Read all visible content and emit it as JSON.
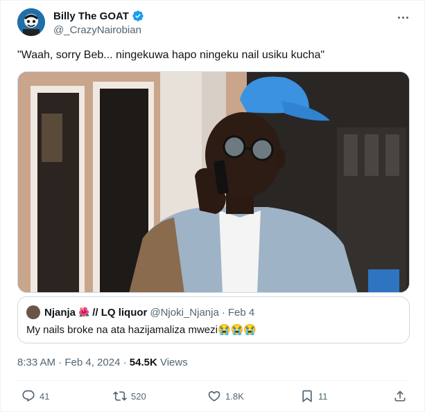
{
  "author": {
    "display_name": "Billy The GOAT",
    "handle": "@_CrazyNairobian",
    "verified": true
  },
  "tweet": {
    "text": "\"Waah, sorry Beb... ningekuwa hapo ningeku nail usiku kucha\""
  },
  "quoted": {
    "name": "Njanja",
    "flower": "🌺",
    "name_suffix": "// LQ liquor",
    "handle": "@Njoki_Njanja",
    "separator": "·",
    "date": "Feb 4",
    "text": "My nails broke na ata hazijamaliza mwezi😭😭😭"
  },
  "meta": {
    "time_date": "8:33 AM · Feb 4, 2024 · ",
    "views_count": "54.5K",
    "views_label": " Views"
  },
  "actions": {
    "replies": "41",
    "reposts": "520",
    "likes": "1.8K",
    "bookmarks": "11"
  },
  "colors": {
    "accent": "#1d9bf0",
    "text": "#0f1419",
    "secondary": "#536471",
    "border": "#cfd9de"
  }
}
